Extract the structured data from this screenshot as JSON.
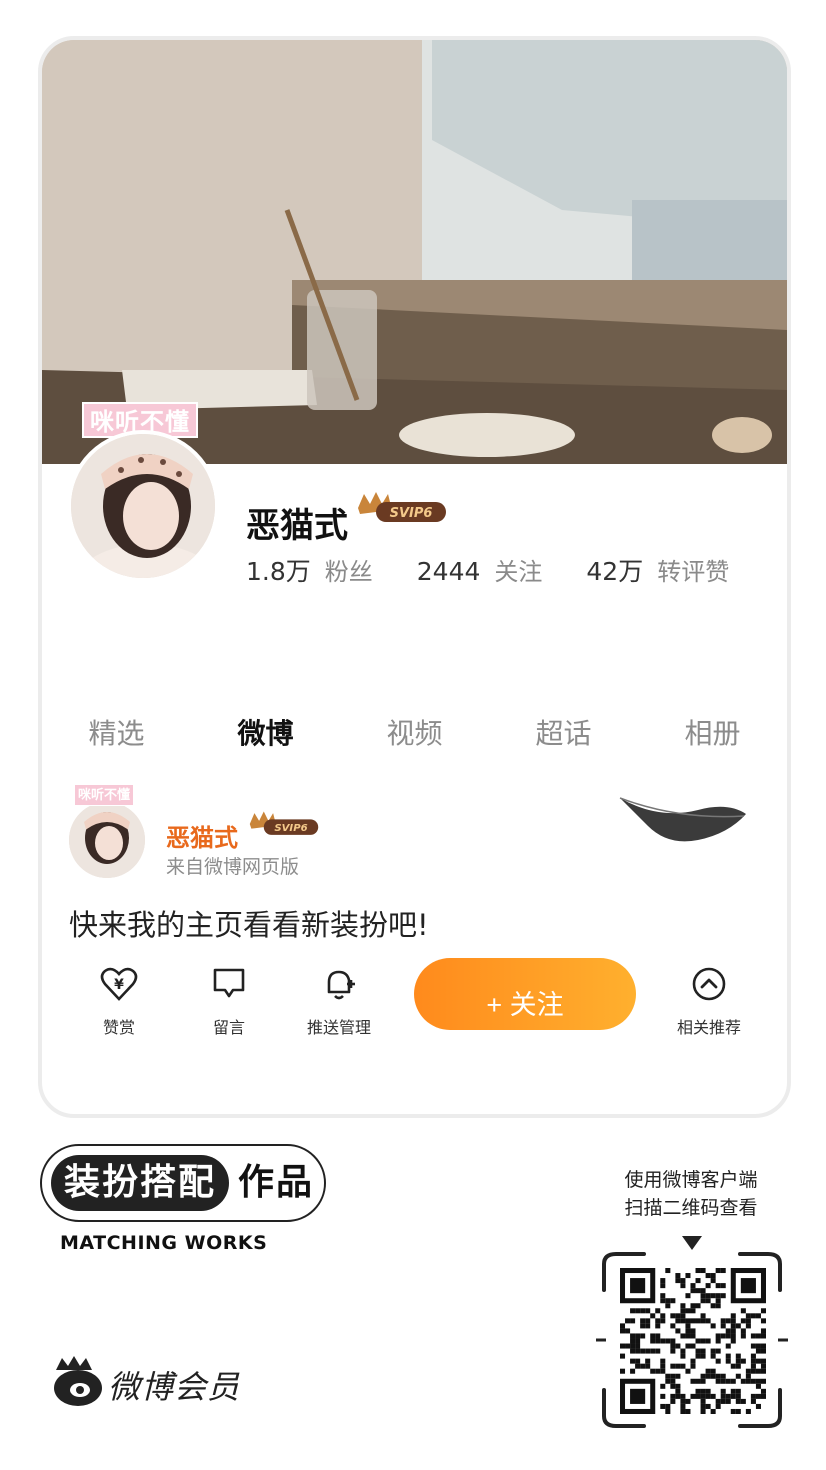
{
  "profile": {
    "tag": "咪听不懂",
    "name": "恶猫式",
    "vip_badge": "SVIP6",
    "stats": [
      {
        "value": "1.8万",
        "label": "粉丝"
      },
      {
        "value": "2444",
        "label": "关注"
      },
      {
        "value": "42万",
        "label": "转评赞"
      }
    ]
  },
  "tabs": [
    "精选",
    "微博",
    "视频",
    "超话",
    "相册"
  ],
  "active_tab": "微博",
  "post": {
    "tag": "咪听不懂",
    "author": "恶猫式",
    "vip_badge": "SVIP6",
    "source": "来自微博网页版",
    "text": "快来我的主页看看新装扮吧!"
  },
  "actions": {
    "reward": "赞赏",
    "message": "留言",
    "push": "推送管理",
    "follow": "+ 关注",
    "related": "相关推荐"
  },
  "footer": {
    "badge_dark": "装扮搭配",
    "badge_light": "作品",
    "subtitle": "MATCHING WORKS",
    "brand": "微博会员",
    "qr_hint_line1": "使用微博客户端",
    "qr_hint_line2": "扫描二维码查看"
  },
  "colors": {
    "accent_orange": "#ff8a1c",
    "author_orange": "#e8691c",
    "tag_pink": "#f7c8d6"
  },
  "icons": [
    "heart-yen-icon",
    "message-icon",
    "bell-plus-icon",
    "chevron-up-circle-icon",
    "crown-icon",
    "feather-icon",
    "weibo-logo-icon",
    "qr-code-icon"
  ]
}
